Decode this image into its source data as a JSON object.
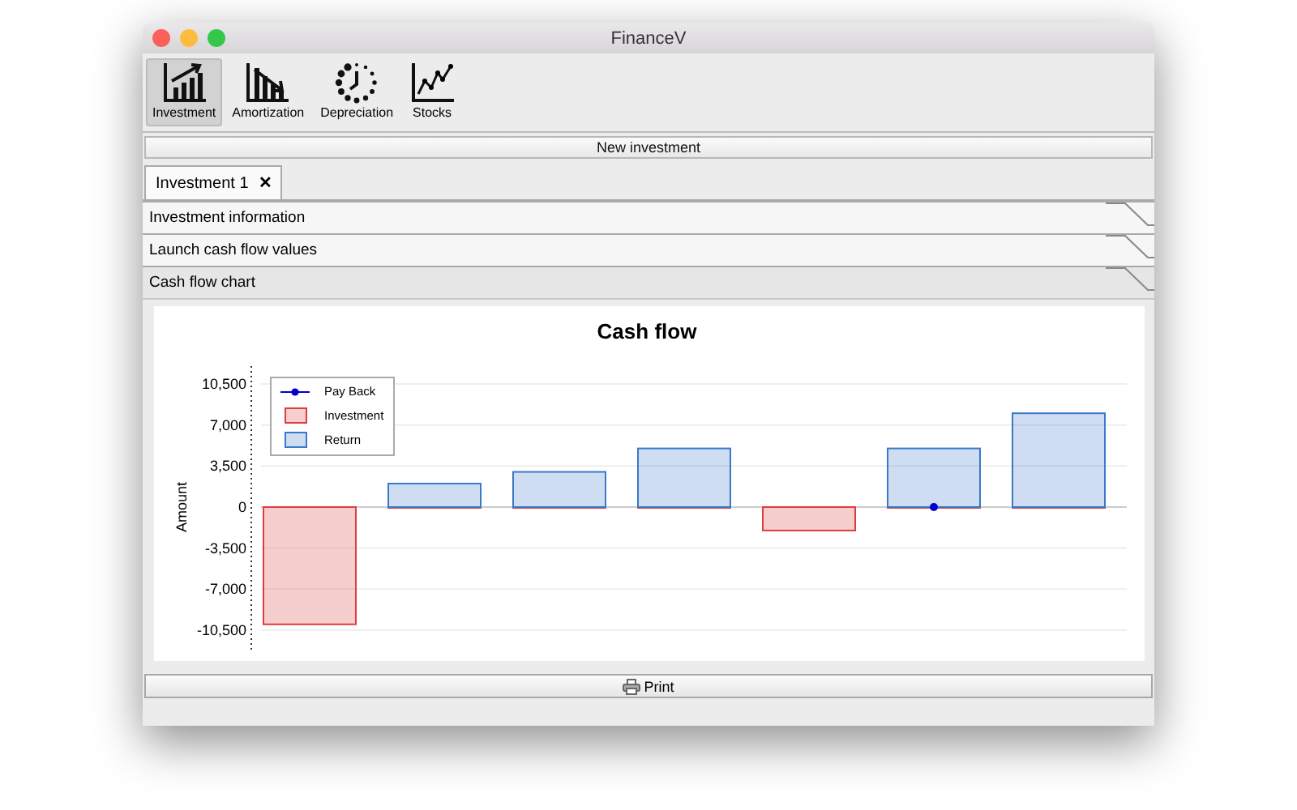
{
  "window": {
    "title": "FinanceV"
  },
  "toolbar": [
    {
      "label": "Investment",
      "kind": "investment",
      "selected": true
    },
    {
      "label": "Amortization",
      "kind": "amortization",
      "selected": false
    },
    {
      "label": "Depreciation",
      "kind": "depreciation",
      "selected": false
    },
    {
      "label": "Stocks",
      "kind": "stocks",
      "selected": false
    }
  ],
  "new_button": "New investment",
  "tabs": [
    {
      "label": "Investment 1",
      "close": "✕",
      "selected": true
    }
  ],
  "sections": [
    {
      "title": "Investment information",
      "expanded": false
    },
    {
      "title": "Launch cash flow values",
      "expanded": false
    },
    {
      "title": "Cash flow chart",
      "expanded": true,
      "chart_data": {
        "type": "bar",
        "title": "Cash flow",
        "ylabel": "Amount",
        "ylim": [
          -10500,
          10500
        ],
        "yticks": [
          {
            "value": 10500,
            "label": "10,500"
          },
          {
            "value": 7000,
            "label": "7,000"
          },
          {
            "value": 3500,
            "label": "3,500"
          },
          {
            "value": 0,
            "label": "0"
          },
          {
            "value": -3500,
            "label": "-3,500"
          },
          {
            "value": -7000,
            "label": "-7,000"
          },
          {
            "value": -10500,
            "label": "-10,500"
          }
        ],
        "grid": true,
        "legend": true,
        "series": [
          {
            "name": "Pay Back",
            "type": "line",
            "marker": "circle",
            "color": "#0000cc",
            "values": [
              null,
              null,
              null,
              null,
              null,
              0,
              null
            ]
          },
          {
            "name": "Investment",
            "type": "bar",
            "color": "#e03c3c",
            "values": [
              -10000,
              0,
              0,
              0,
              -2000,
              0,
              0
            ]
          },
          {
            "name": "Return",
            "type": "bar",
            "color": "#3a78c8",
            "values": [
              null,
              2000,
              3000,
              5000,
              null,
              5000,
              8000
            ]
          }
        ]
      }
    }
  ],
  "print_button": "Print"
}
